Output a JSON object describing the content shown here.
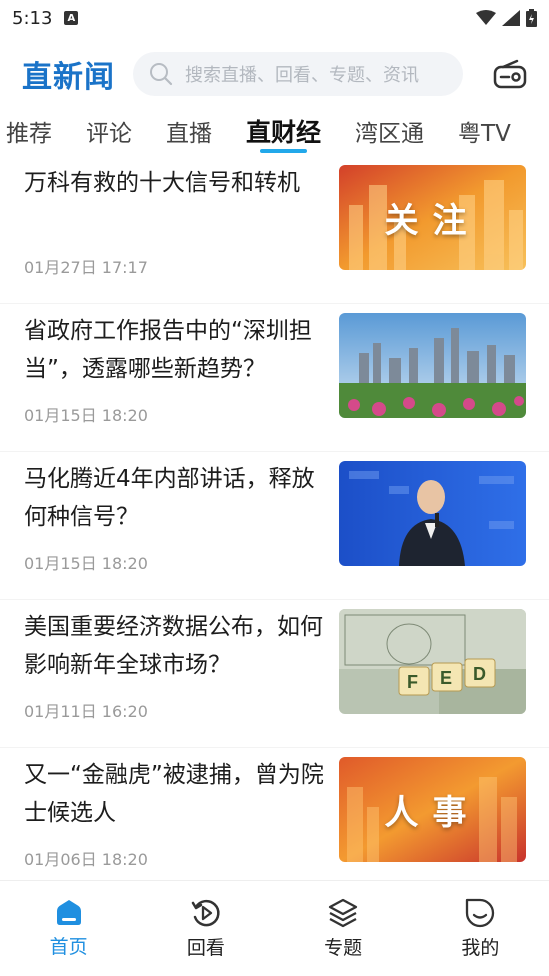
{
  "status": {
    "time": "5:13",
    "a_label": "A"
  },
  "header": {
    "logo": "直新闻",
    "search_placeholder": "搜索直播、回看、专题、资讯"
  },
  "tabs": [
    "推荐",
    "评论",
    "直播",
    "直财经",
    "湾区通",
    "粤TV"
  ],
  "active_tab": "直财经",
  "articles": [
    {
      "title": "万科有救的十大信号和转机",
      "date": "01月27日 17:17",
      "thumb_label": "关注",
      "thumb": "finance-buildings"
    },
    {
      "title": "省政府工作报告中的“深圳担当”，透露哪些新趋势？",
      "date": "01月15日 18:20",
      "thumb_label": "",
      "thumb": "city-skyline"
    },
    {
      "title": "马化腾近4年内部讲话，释放何种信号？",
      "date": "01月15日 18:20",
      "thumb_label": "",
      "thumb": "speaker-photo"
    },
    {
      "title": "美国重要经济数据公布，如何影响新年全球市场？",
      "date": "01月11日 16:20",
      "thumb_label": "",
      "thumb": "dollar-fed"
    },
    {
      "title": "又一“金融虎”被逮捕，曾为院士候选人",
      "date": "01月06日 18:20",
      "thumb_label": "人事",
      "thumb": "finance-buildings"
    }
  ],
  "bottom_nav": [
    {
      "label": "首页",
      "icon": "home-icon",
      "active": true
    },
    {
      "label": "回看",
      "icon": "replay-icon",
      "active": false
    },
    {
      "label": "专题",
      "icon": "layers-icon",
      "active": false
    },
    {
      "label": "我的",
      "icon": "profile-icon",
      "active": false
    }
  ],
  "colors": {
    "accent": "#1f8fe0",
    "tab_underline": "#22a8ea"
  }
}
